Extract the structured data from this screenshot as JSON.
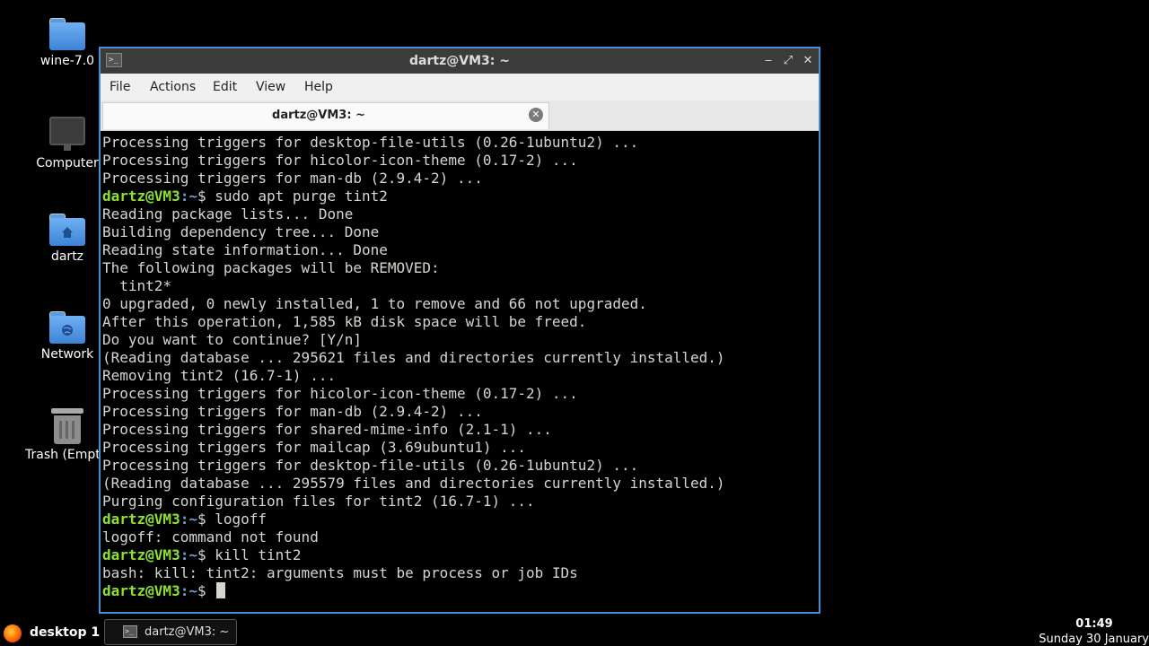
{
  "desktop": {
    "icons": [
      {
        "label": "wine-7.0",
        "icon": "folder-icon"
      },
      {
        "label": "Computer",
        "icon": "computer-icon"
      },
      {
        "label": "dartz",
        "icon": "home-folder-icon"
      },
      {
        "label": "Network",
        "icon": "network-folder-icon"
      },
      {
        "label": "Trash (Empty)",
        "icon": "trash-icon"
      }
    ]
  },
  "window": {
    "title": "dartz@VM3: ~",
    "controls": {
      "minimize": "‒",
      "maximize": "⤢",
      "close": "✕"
    },
    "menu": [
      "File",
      "Actions",
      "Edit",
      "View",
      "Help"
    ],
    "tab": {
      "label": "dartz@VM3: ~",
      "close": "✕"
    }
  },
  "terminal": {
    "prompt_user": "dartz@VM3",
    "prompt_path": ":~",
    "prompt_symbol": "$ ",
    "lines": [
      {
        "type": "out",
        "text": "Processing triggers for desktop-file-utils (0.26-1ubuntu2) ..."
      },
      {
        "type": "out",
        "text": "Processing triggers for hicolor-icon-theme (0.17-2) ..."
      },
      {
        "type": "out",
        "text": "Processing triggers for man-db (2.9.4-2) ..."
      },
      {
        "type": "cmd",
        "text": "sudo apt purge tint2"
      },
      {
        "type": "out",
        "text": "Reading package lists... Done"
      },
      {
        "type": "out",
        "text": "Building dependency tree... Done"
      },
      {
        "type": "out",
        "text": "Reading state information... Done"
      },
      {
        "type": "out",
        "text": "The following packages will be REMOVED:"
      },
      {
        "type": "out",
        "text": "  tint2*"
      },
      {
        "type": "out",
        "text": "0 upgraded, 0 newly installed, 1 to remove and 66 not upgraded."
      },
      {
        "type": "out",
        "text": "After this operation, 1,585 kB disk space will be freed."
      },
      {
        "type": "out",
        "text": "Do you want to continue? [Y/n]"
      },
      {
        "type": "out",
        "text": "(Reading database ... 295621 files and directories currently installed.)"
      },
      {
        "type": "out",
        "text": "Removing tint2 (16.7-1) ..."
      },
      {
        "type": "out",
        "text": "Processing triggers for hicolor-icon-theme (0.17-2) ..."
      },
      {
        "type": "out",
        "text": "Processing triggers for man-db (2.9.4-2) ..."
      },
      {
        "type": "out",
        "text": "Processing triggers for shared-mime-info (2.1-1) ..."
      },
      {
        "type": "out",
        "text": "Processing triggers for mailcap (3.69ubuntu1) ..."
      },
      {
        "type": "out",
        "text": "Processing triggers for desktop-file-utils (0.26-1ubuntu2) ..."
      },
      {
        "type": "out",
        "text": "(Reading database ... 295579 files and directories currently installed.)"
      },
      {
        "type": "out",
        "text": "Purging configuration files for tint2 (16.7-1) ..."
      },
      {
        "type": "cmd",
        "text": "logoff"
      },
      {
        "type": "out",
        "text": "logoff: command not found"
      },
      {
        "type": "cmd",
        "text": "kill tint2"
      },
      {
        "type": "out",
        "text": "bash: kill: tint2: arguments must be process or job IDs"
      },
      {
        "type": "cmd",
        "text": "",
        "cursor": true
      }
    ]
  },
  "taskbar": {
    "browser_icon": "firefox-icon",
    "desktop_label": "desktop 1",
    "task_label": "dartz@VM3: ~",
    "time": "01:49",
    "date": "Sunday 30 January"
  },
  "colors": {
    "prompt_user": "#8ae234",
    "prompt_path": "#729fcf",
    "accent": "#4a90d9"
  }
}
